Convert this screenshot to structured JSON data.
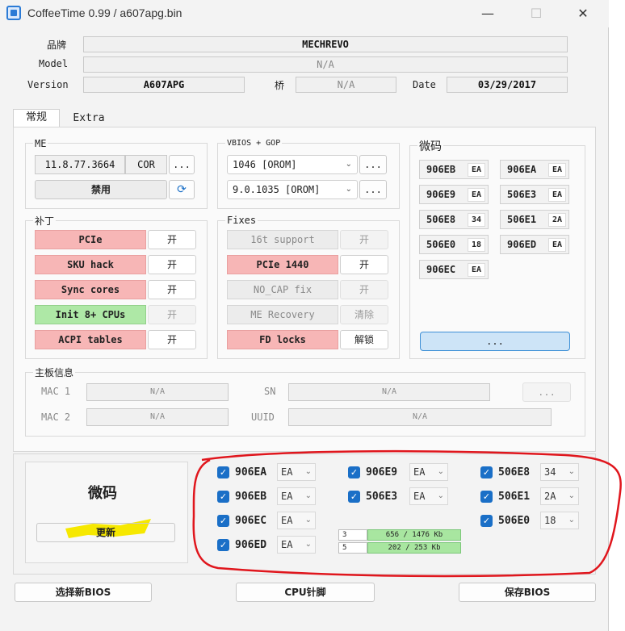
{
  "window": {
    "title": "CoffeeTime 0.99  /  a607apg.bin",
    "minimize": "—",
    "maximize": "☐",
    "close": "✕"
  },
  "info": {
    "brand_label": "品牌",
    "brand_value": "MECHREVO",
    "model_label": "Model",
    "model_value": "N/A",
    "version_label": "Version",
    "version_value": "A607APG",
    "bridge_label": "桥",
    "bridge_value": "N/A",
    "date_label": "Date",
    "date_value": "03/29/2017"
  },
  "tabs": [
    "常规",
    "Extra"
  ],
  "me": {
    "title": "ME",
    "version": "11.8.77.3664",
    "type": "COR",
    "more": "...",
    "disable": "禁用",
    "refresh_icon": "refresh-icon"
  },
  "vbios": {
    "title": "VBIOS + GOP",
    "vbios_value": "1046 [OROM]",
    "gop_value": "9.0.1035 [OROM]",
    "more": "..."
  },
  "patches": {
    "title": "补丁",
    "items": [
      {
        "label": "PCIe",
        "toggle": "开"
      },
      {
        "label": "SKU hack",
        "toggle": "开"
      },
      {
        "label": "Sync cores",
        "toggle": "开"
      },
      {
        "label": "Init 8+ CPUs",
        "toggle": "开"
      },
      {
        "label": "ACPI tables",
        "toggle": "开"
      }
    ]
  },
  "fixes": {
    "title": "Fixes",
    "items": [
      {
        "label": "16t support",
        "toggle": "开"
      },
      {
        "label": "PCIe 1440",
        "toggle": "开"
      },
      {
        "label": "NO_CAP fix",
        "toggle": "开"
      },
      {
        "label": "ME Recovery",
        "toggle": "清除"
      },
      {
        "label": "FD locks",
        "toggle": "解锁"
      }
    ]
  },
  "microcode": {
    "title": "微码",
    "chips": [
      {
        "code": "906EB",
        "rev": "EA"
      },
      {
        "code": "906EA",
        "rev": "EA"
      },
      {
        "code": "906E9",
        "rev": "EA"
      },
      {
        "code": "506E3",
        "rev": "EA"
      },
      {
        "code": "506E8",
        "rev": "34"
      },
      {
        "code": "506E1",
        "rev": "2A"
      },
      {
        "code": "506E0",
        "rev": "18"
      },
      {
        "code": "906ED",
        "rev": "EA"
      },
      {
        "code": "906EC",
        "rev": "EA"
      }
    ],
    "more": "..."
  },
  "board": {
    "title": "主板信息",
    "mac1_label": "MAC 1",
    "mac1_value": "N/A",
    "mac2_label": "MAC 2",
    "mac2_value": "N/A",
    "sn_label": "SN",
    "sn_value": "N/A",
    "uuid_label": "UUID",
    "uuid_value": "N/A",
    "more": "..."
  },
  "update": {
    "title": "微码",
    "button": "更新",
    "entries": [
      {
        "code": "906EA",
        "rev": "EA"
      },
      {
        "code": "906E9",
        "rev": "EA"
      },
      {
        "code": "506E8",
        "rev": "34"
      },
      {
        "code": "906EB",
        "rev": "EA"
      },
      {
        "code": "506E3",
        "rev": "EA"
      },
      {
        "code": "506E1",
        "rev": "2A"
      },
      {
        "code": "906EC",
        "rev": "EA"
      },
      {
        "code": "506E0",
        "rev": "18"
      },
      {
        "code": "906ED",
        "rev": "EA"
      }
    ],
    "progress": [
      {
        "index": "3",
        "text": "656 / 1476 Kb",
        "fraction": 0.444
      },
      {
        "index": "5",
        "text": "202 / 253 Kb",
        "fraction": 0.798
      }
    ]
  },
  "footer": {
    "select_bios": "选择新BIOS",
    "cpu_pins": "CPU针脚",
    "save_bios": "保存BIOS"
  },
  "colors": {
    "red_patch": "#f7b6b6",
    "green_patch": "#aee8a6",
    "checkbox_blue": "#1a6fc7",
    "annotation_red": "#e0161d",
    "highlight_yellow": "#f6e800"
  }
}
